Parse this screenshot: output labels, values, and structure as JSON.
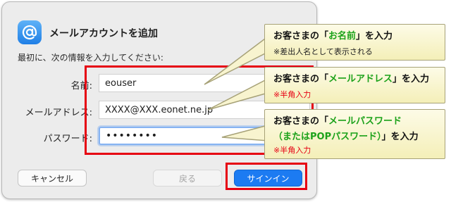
{
  "dialog": {
    "title": "メールアカウントを追加",
    "instruction": "最初に、次の情報を入力してください:",
    "fields": {
      "name": {
        "label": "名前:",
        "value": "eouser"
      },
      "email": {
        "label": "メールアドレス:",
        "value": "XXXX@XXX.eonet.ne.jp"
      },
      "password": {
        "label": "パスワード:",
        "value": "••••••••"
      }
    },
    "buttons": {
      "cancel": "キャンセル",
      "back": "戻る",
      "sign_in": "サインイン"
    }
  },
  "callouts": {
    "name": {
      "pre": "お客さまの「",
      "highlight": "お名前",
      "post": "」を入力",
      "note": "※差出人名として表示される"
    },
    "email": {
      "pre": "お客さまの「",
      "highlight": "メールアドレス",
      "post": "」を入力",
      "note": "※半角入力"
    },
    "password": {
      "pre": "お客さまの「",
      "highlight1": "メールパスワード",
      "highlight2": "（またはPOPパスワード）",
      "post": "」を入力",
      "note": "※半角入力"
    }
  },
  "colors": {
    "highlight_green": "#1ca21a",
    "note_red": "#e60012",
    "frame_red": "#e60012",
    "accent_blue": "#1c7bf2"
  }
}
